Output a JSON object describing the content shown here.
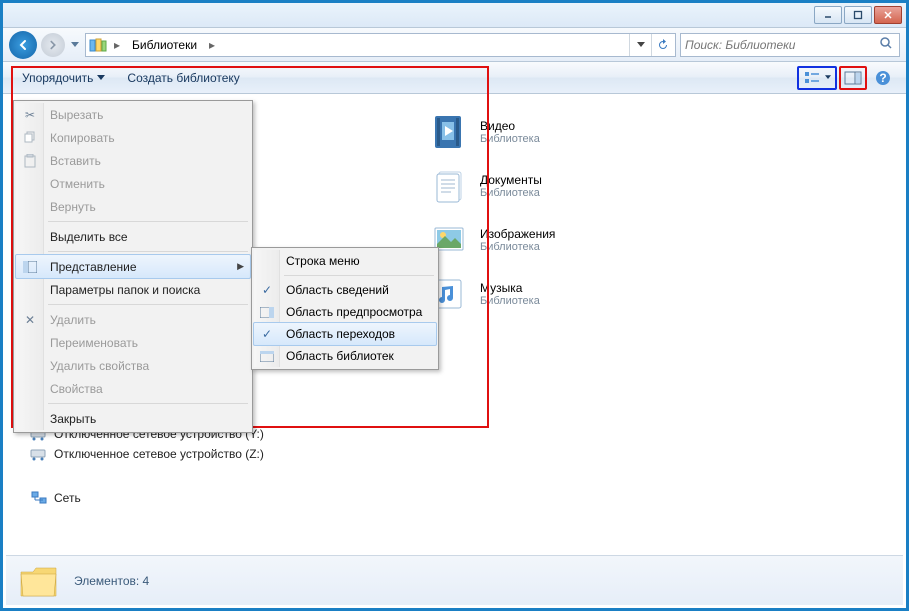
{
  "window": {
    "breadcrumb": "Библиотеки",
    "breadcrumb_arrow": "▸",
    "search_placeholder": "Поиск: Библиотеки"
  },
  "toolbar": {
    "organize": "Упорядочить",
    "new_library": "Создать библиотеку"
  },
  "organize_menu": {
    "cut": "Вырезать",
    "copy": "Копировать",
    "paste": "Вставить",
    "undo": "Отменить",
    "redo": "Вернуть",
    "select_all": "Выделить все",
    "layout": "Представление",
    "folder_options": "Параметры папок и поиска",
    "delete": "Удалить",
    "rename": "Переименовать",
    "remove_props": "Удалить свойства",
    "properties": "Свойства",
    "close": "Закрыть"
  },
  "layout_submenu": {
    "menu_bar": "Строка меню",
    "details_pane": "Область сведений",
    "preview_pane": "Область предпросмотра",
    "navigation_pane": "Область переходов",
    "library_pane": "Область библиотек"
  },
  "libraries": [
    {
      "name": "Видео",
      "sub": "Библиотека"
    },
    {
      "name": "Документы",
      "sub": "Библиотека"
    },
    {
      "name": "Изображения",
      "sub": "Библиотека"
    },
    {
      "name": "Музыка",
      "sub": "Библиотека"
    }
  ],
  "tree": {
    "drive_y": "Отключенное сетевое устройство (Y:)",
    "drive_z": "Отключенное сетевое устройство (Z:)",
    "network": "Сеть"
  },
  "status": {
    "count_label": "Элементов: 4"
  }
}
